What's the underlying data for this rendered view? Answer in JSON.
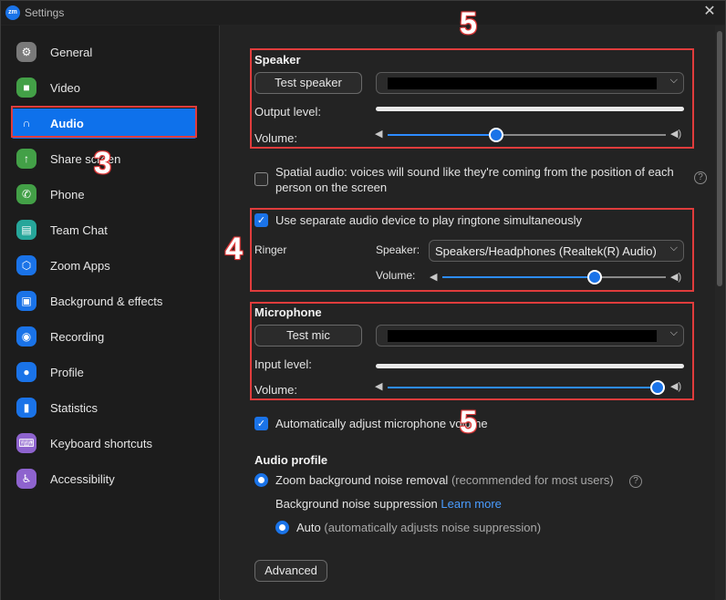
{
  "window": {
    "title": "Settings",
    "logo_text": "zm",
    "close_glyph": "✕"
  },
  "sidebar": {
    "items": [
      {
        "label": "General",
        "icon": "gear-icon",
        "color": "#7a7a7a",
        "glyph": "⚙"
      },
      {
        "label": "Video",
        "icon": "video-icon",
        "color": "#43a047",
        "glyph": "■"
      },
      {
        "label": "Audio",
        "icon": "headphones-icon",
        "color": "#0e71eb",
        "glyph": "∩"
      },
      {
        "label": "Share screen",
        "icon": "share-screen-icon",
        "color": "#43a047",
        "glyph": "↑"
      },
      {
        "label": "Phone",
        "icon": "phone-icon",
        "color": "#43a047",
        "glyph": "✆"
      },
      {
        "label": "Team Chat",
        "icon": "chat-icon",
        "color": "#26a69a",
        "glyph": "▤"
      },
      {
        "label": "Zoom Apps",
        "icon": "apps-icon",
        "color": "#1a73e8",
        "glyph": "⬡"
      },
      {
        "label": "Background & effects",
        "icon": "background-icon",
        "color": "#1a73e8",
        "glyph": "▣"
      },
      {
        "label": "Recording",
        "icon": "recording-icon",
        "color": "#1a73e8",
        "glyph": "◉"
      },
      {
        "label": "Profile",
        "icon": "profile-icon",
        "color": "#1a73e8",
        "glyph": "●"
      },
      {
        "label": "Statistics",
        "icon": "statistics-icon",
        "color": "#1a73e8",
        "glyph": "▮"
      },
      {
        "label": "Keyboard shortcuts",
        "icon": "keyboard-icon",
        "color": "#8e63ce",
        "glyph": "⌨"
      },
      {
        "label": "Accessibility",
        "icon": "accessibility-icon",
        "color": "#8e63ce",
        "glyph": "♿"
      }
    ],
    "active_index": 2
  },
  "annotations": {
    "n3": "3",
    "n4": "4",
    "n5a": "5",
    "n5b": "5"
  },
  "speaker": {
    "title": "Speaker",
    "test_button": "Test speaker",
    "output_level_label": "Output level:",
    "volume_label": "Volume:",
    "volume_fraction": 0.39
  },
  "spatial_audio": {
    "label_line1": "Spatial audio: voices will sound like they're coming from the position of each",
    "label_line2": "person on the screen",
    "checked": false
  },
  "ringtone": {
    "checkbox_label": "Use separate audio device to play ringtone simultaneously",
    "checked": true,
    "ringer_label": "Ringer",
    "speaker_label": "Speaker:",
    "speaker_value": "Speakers/Headphones (Realtek(R) Audio)",
    "volume_label": "Volume:",
    "volume_fraction": 0.68
  },
  "microphone": {
    "title": "Microphone",
    "test_button": "Test mic",
    "input_level_label": "Input level:",
    "volume_label": "Volume:",
    "volume_fraction": 1.0
  },
  "auto_adjust": {
    "label": "Automatically adjust microphone volume",
    "checked": true
  },
  "audio_profile": {
    "title": "Audio profile",
    "zoom_noise_label": "Zoom background noise removal",
    "zoom_noise_hint": "(recommended for most users)",
    "suppression_label": "Background noise suppression",
    "learn_more": "Learn more",
    "auto_label": "Auto",
    "auto_hint": "(automatically adjusts noise suppression)"
  },
  "advanced_button": "Advanced"
}
